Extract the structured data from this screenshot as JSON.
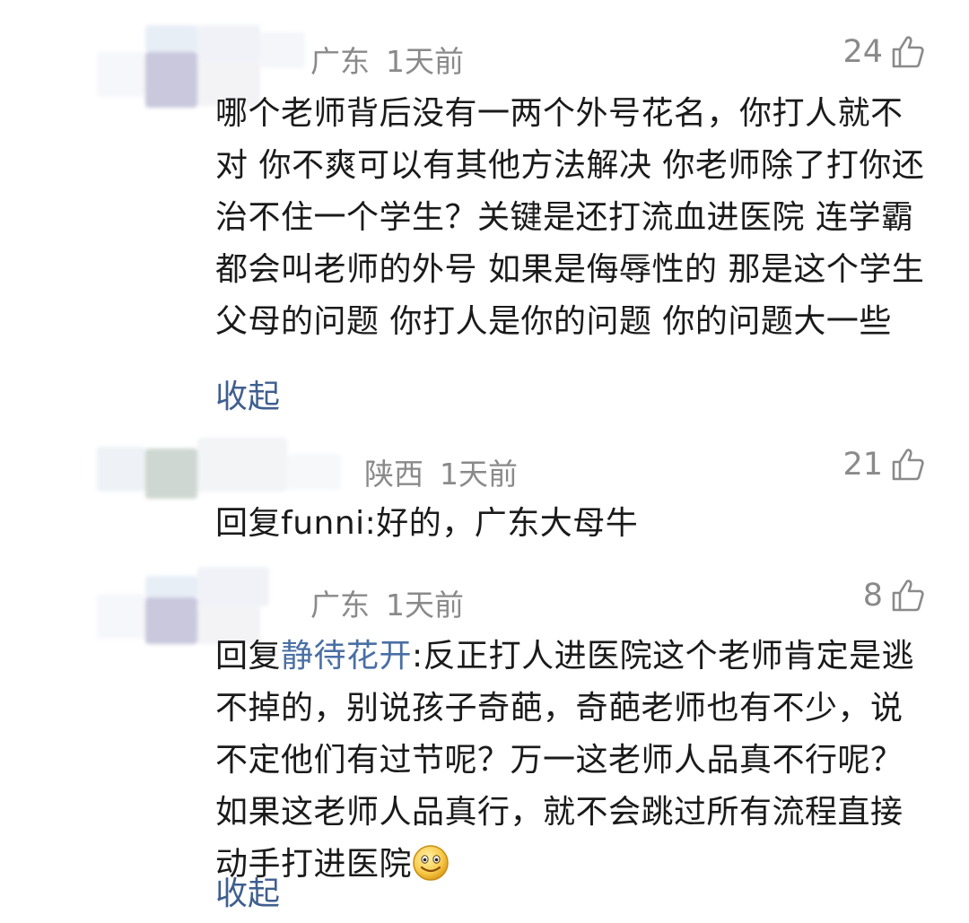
{
  "comments": [
    {
      "location": "广东",
      "time": "1天前",
      "likes": "24",
      "prefix": "",
      "reply_to": "",
      "text": "哪个老师背后没有一两个外号花名，你打人就不对  你不爽可以有其他方法解决   你老师除了打你还治不住一个学生？关键是还打流血进医院 连学霸都会叫老师的外号 如果是侮辱性的 那是这个学生父母的问题 你打人是你的问题  你的问题大一些",
      "collapse_label": "收起"
    },
    {
      "location": "陕西",
      "time": "1天前",
      "likes": "21",
      "prefix": "回复",
      "reply_to": "funni",
      "text": ":好的，广东大母牛",
      "collapse_label": ""
    },
    {
      "location": "广东",
      "time": "1天前",
      "likes": "8",
      "prefix": "回复",
      "reply_to": "静待花开",
      "text": ":反正打人进医院这个老师肯定是逃不掉的，别说孩子奇葩，奇葩老师也有不少，说不定他们有过节呢？万一这老师人品真不行呢？ 如果这老师人品真行，就不会跳过所有流程直接动手打进医院",
      "emoji": "smiley-emoji",
      "collapse_label": "收起"
    }
  ],
  "colors": {
    "meta": "#8a8a8a",
    "text": "#1a1a1a",
    "link": "#3f5f8f",
    "reply_name": "#4a6fa5"
  }
}
